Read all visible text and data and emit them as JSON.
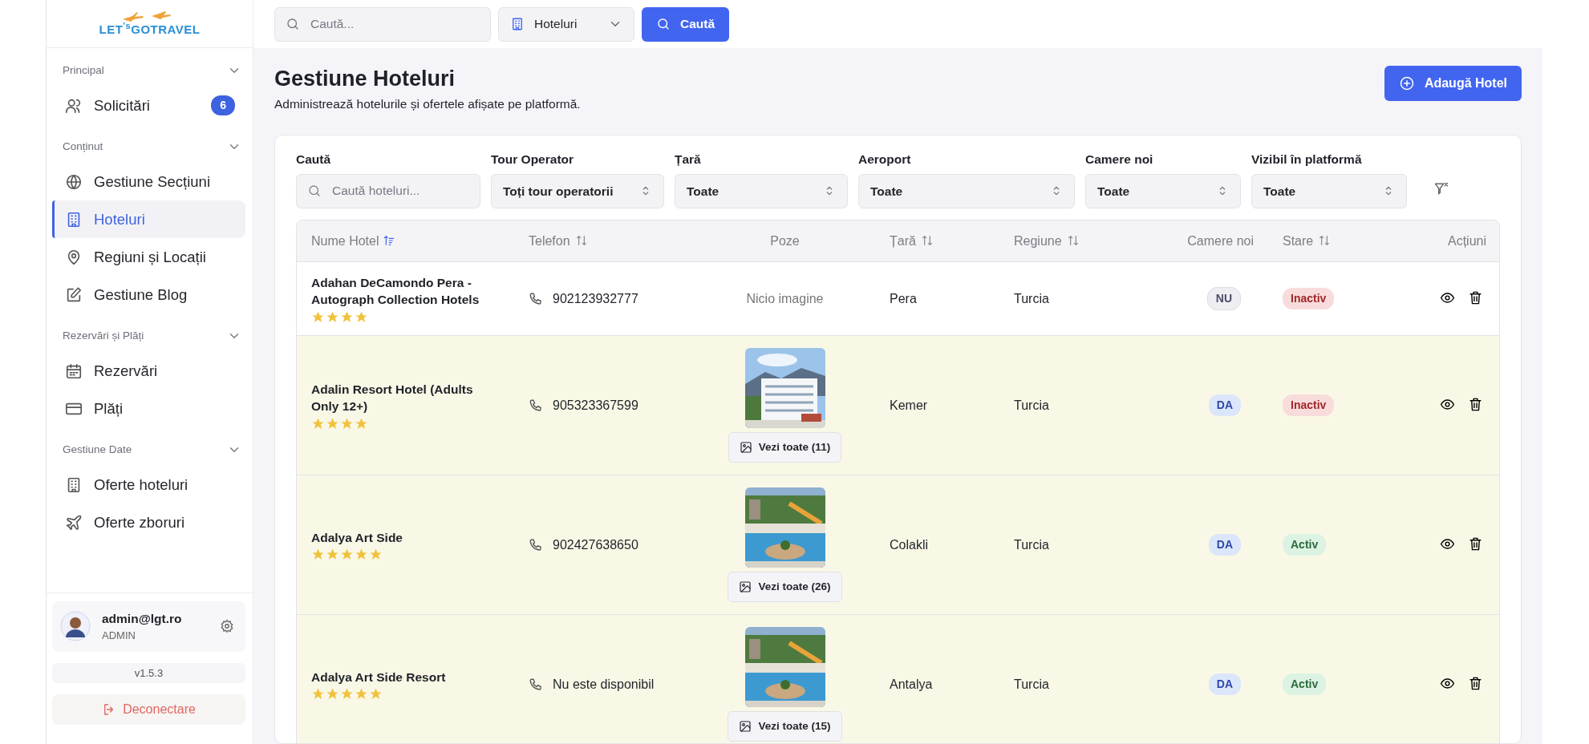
{
  "logo": {
    "text": "LET$^{'s}$GOTRAVEL"
  },
  "sidebar": {
    "sections": [
      {
        "title": "Principal",
        "expanded": true,
        "items": [
          {
            "label": "Solicitări",
            "selected": false,
            "badge": "6"
          }
        ]
      },
      {
        "title": "Conținut",
        "expanded": true,
        "items": [
          {
            "label": "Gestiune Secțiuni",
            "selected": false
          },
          {
            "label": "Hoteluri",
            "selected": true
          },
          {
            "label": "Regiuni și Locații",
            "selected": false
          },
          {
            "label": "Gestiune Blog",
            "selected": false
          }
        ]
      },
      {
        "title": "Rezervări și Plăți",
        "expanded": true,
        "items": [
          {
            "label": "Rezervări",
            "selected": false
          },
          {
            "label": "Plăți",
            "selected": false
          }
        ]
      },
      {
        "title": "Gestiune Date",
        "expanded": true,
        "items": [
          {
            "label": "Oferte hoteluri",
            "selected": false
          },
          {
            "label": "Oferte zboruri",
            "selected": false
          }
        ]
      }
    ],
    "user": {
      "email": "admin@lgt.ro",
      "role": "ADMIN"
    },
    "version": "v1.5.3",
    "logout": "Deconectare"
  },
  "topbar": {
    "search_placeholder": "Caută...",
    "type_select": "Hoteluri",
    "search_button": "Caută"
  },
  "header": {
    "title": "Gestiune Hoteluri",
    "subtitle": "Administrează hotelurile și ofertele afișate pe platformă.",
    "add_button": "Adaugă Hotel"
  },
  "filters": [
    {
      "kind": "search",
      "label": "Caută",
      "placeholder": "Caută hoteluri..."
    },
    {
      "kind": "select",
      "label": "Tour Operator",
      "value": "Toți tour operatorii"
    },
    {
      "kind": "select",
      "label": "Țară",
      "value": "Toate"
    },
    {
      "kind": "select",
      "label": "Aeroport",
      "value": "Toate"
    },
    {
      "kind": "select",
      "label": "Camere noi",
      "value": "Toate"
    },
    {
      "kind": "select",
      "label": "Vizibil în platformă",
      "value": "Toate"
    }
  ],
  "table": {
    "columns": [
      {
        "label": "Nume Hotel",
        "sortable": true,
        "sorted": true
      },
      {
        "label": "Telefon",
        "sortable": true,
        "sorted": false
      },
      {
        "label": "Poze",
        "sortable": false
      },
      {
        "label": "Țară",
        "sortable": true,
        "sorted": false
      },
      {
        "label": "Regiune",
        "sortable": true,
        "sorted": false
      },
      {
        "label": "Camere noi",
        "sortable": false
      },
      {
        "label": "Stare",
        "sortable": true,
        "sorted": false
      },
      {
        "label": "Acțiuni",
        "sortable": false
      }
    ],
    "rows": [
      {
        "name": "Adahan DeCamondo Pera - Autograph Collection Hotels",
        "stars": 4,
        "phone": "902123932777",
        "photos": {
          "kind": "none",
          "text": "Nicio imagine"
        },
        "country": "Pera",
        "region": "Turcia",
        "new_rooms": {
          "kind": "no",
          "text": "NU"
        },
        "status": {
          "kind": "inactive",
          "text": "Inactiv"
        },
        "highlighted": false
      },
      {
        "name": "Adalin Resort Hotel (Adults Only 12+)",
        "stars": 4,
        "phone": "905323367599",
        "photos": {
          "kind": "picture",
          "button": "Vezi toate (11)"
        },
        "country": "Kemer",
        "region": "Turcia",
        "new_rooms": {
          "kind": "yes",
          "text": "DA"
        },
        "status": {
          "kind": "inactive",
          "text": "Inactiv"
        },
        "highlighted": true
      },
      {
        "name": "Adalya Art Side",
        "stars": 5,
        "phone": "902427638650",
        "photos": {
          "kind": "picture",
          "button": "Vezi toate (26)"
        },
        "country": "Colakli",
        "region": "Turcia",
        "new_rooms": {
          "kind": "yes",
          "text": "DA"
        },
        "status": {
          "kind": "active",
          "text": "Activ"
        },
        "highlighted": true
      },
      {
        "name": "Adalya Art Side Resort",
        "stars": 5,
        "phone": "Nu este disponibil",
        "photos": {
          "kind": "picture",
          "button": "Vezi toate (15)"
        },
        "country": "Antalya",
        "region": "Turcia",
        "new_rooms": {
          "kind": "yes",
          "text": "DA"
        },
        "status": {
          "kind": "active",
          "text": "Activ"
        },
        "highlighted": true
      }
    ]
  }
}
